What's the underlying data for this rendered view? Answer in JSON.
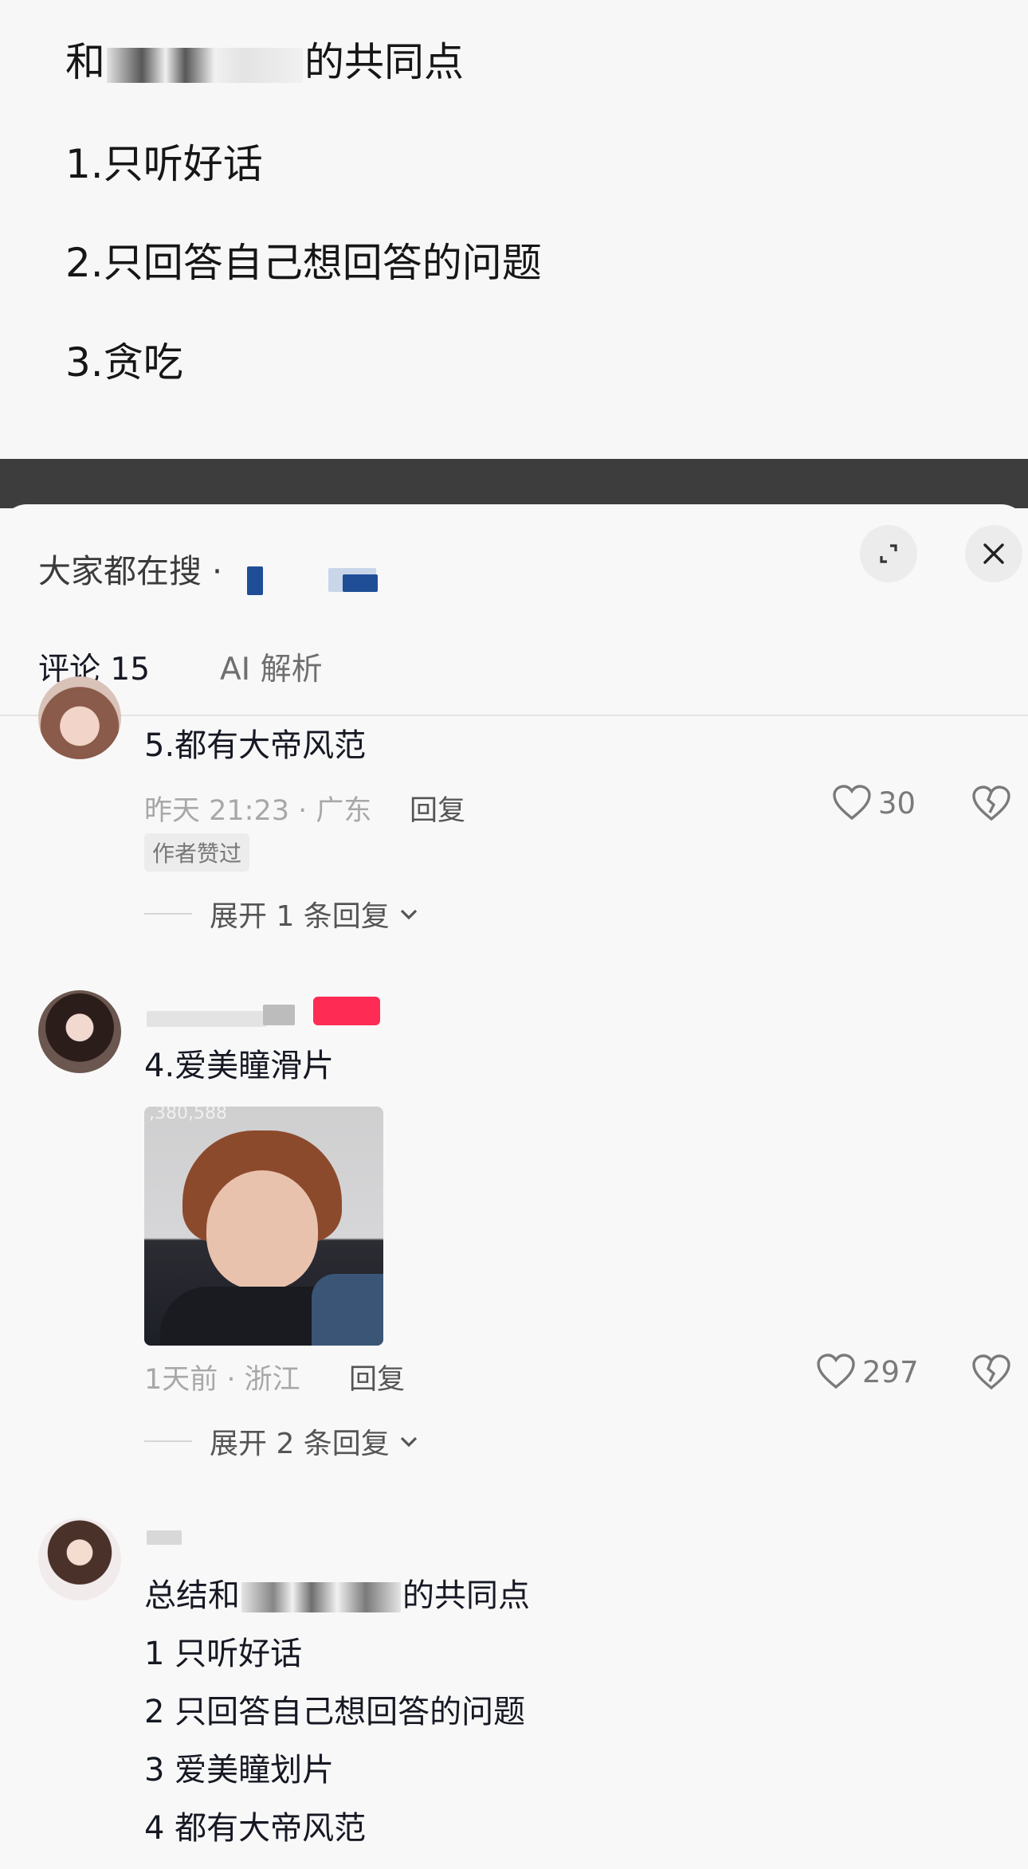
{
  "post": {
    "line0": "和",
    "line0_tail": "的共同点",
    "line1": "1.只听好话",
    "line2": "2.只回答自己想回答的问题",
    "line3": "3.贪吃"
  },
  "sheet": {
    "search_hint": "大家都在搜 ·",
    "tabs": [
      {
        "label": "评论 15"
      },
      {
        "label": "AI 解析"
      }
    ]
  },
  "comments": [
    {
      "text": "5.都有大帝风范",
      "time": "昨天 21:23 · 广东",
      "reply_label": "回复",
      "likes": "30",
      "badge": "作者赞过",
      "expand": "展开 1 条回复"
    },
    {
      "text": "4.爱美瞳滑片",
      "time": "1天前 · 浙江",
      "reply_label": "回复",
      "likes": "297",
      "expand": "展开 2 条回复",
      "image_caption": ",380,588"
    },
    {
      "text_line0_head": "总结和",
      "text_line0_tail": "的共同点",
      "text_line1": "1 只听好话",
      "text_line2": "2 只回答自己想回答的问题",
      "text_line3": "3 爱美瞳划片",
      "text_line4": "4 都有大帝风范"
    }
  ],
  "colors": {
    "text": "#161823",
    "meta": "#a8a8a8",
    "band": "#3d3d3d",
    "red_badge": "#fe2c55"
  },
  "icons": [
    "expand-icon",
    "close-icon",
    "heart-icon",
    "broken-heart-icon",
    "chevron-down-icon"
  ]
}
